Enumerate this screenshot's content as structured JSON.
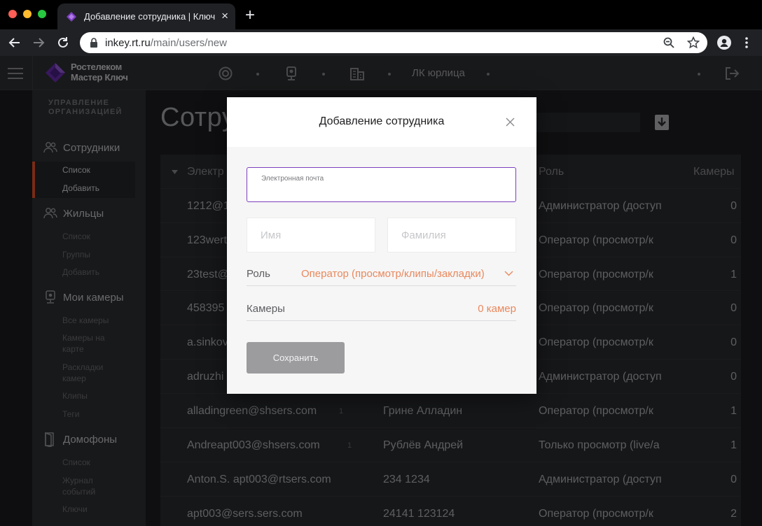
{
  "browser": {
    "tab_title": "Добавление сотрудника | Ключ",
    "tab_close": "×",
    "new_tab": "+",
    "url_host": "inkey.rt.ru",
    "url_path": "/main/users/new"
  },
  "header": {
    "logo_line1": "Ростелеком",
    "logo_line2": "Мастер Ключ",
    "company_label": "ЛК юрлица"
  },
  "sidebar": {
    "section_title_line1": "УПРАВЛЕНИЕ",
    "section_title_line2": "ОРГАНИЗАЦИЕЙ",
    "employees": {
      "label": "Сотрудники",
      "items": [
        "Список",
        "Добавить"
      ]
    },
    "residents": {
      "label": "Жильцы",
      "items": [
        "Список",
        "Группы",
        "Добавить"
      ]
    },
    "cameras": {
      "label": "Мои камеры",
      "items": [
        "Все камеры",
        "Камеры на",
        "карте",
        "Раскладки",
        "камер",
        "Клипы",
        "Теги"
      ]
    },
    "intercoms": {
      "label": "Домофоны",
      "items": [
        "Список",
        "Журнал",
        "событий",
        "Ключи"
      ]
    }
  },
  "main": {
    "title": "Сотру",
    "columns": {
      "email": "Электр",
      "role": "Роль",
      "cameras": "Камеры"
    },
    "rows": [
      {
        "email": "1212@12",
        "count": "",
        "name": "",
        "role": "Администратор (доступ",
        "cameras": "0"
      },
      {
        "email": "123wert",
        "count": "",
        "name": "",
        "role": "Оператор (просмотр/к",
        "cameras": "0"
      },
      {
        "email": "23test@",
        "count": "",
        "name": "",
        "role": "Оператор (просмотр/к",
        "cameras": "1"
      },
      {
        "email": "458395",
        "count": "",
        "name": "",
        "role": "Оператор (просмотр/к",
        "cameras": "0"
      },
      {
        "email": "a.sinkov",
        "count": "",
        "name": "",
        "role": "Оператор (просмотр/к",
        "cameras": "0"
      },
      {
        "email": "adruzhi",
        "count": "",
        "name": "",
        "role": "Администратор (доступ",
        "cameras": "0"
      },
      {
        "email": "alladingreen@shsers.com",
        "count": "1",
        "name": "Грине Алладин",
        "role": "Оператор (просмотр/к",
        "cameras": "1"
      },
      {
        "email": "Andreapt003@shsers.com",
        "count": "1",
        "name": "Рублёв Андрей",
        "role": "Только просмотр (live/а",
        "cameras": "1"
      },
      {
        "email": "Anton.S. apt003@rtsers.com",
        "count": "",
        "name": "234 1234",
        "role": "Администратор (доступ",
        "cameras": "0"
      },
      {
        "email": "apt003@sers.sers.com",
        "count": "",
        "name": "24141 123124",
        "role": "Оператор (просмотр/к",
        "cameras": "2"
      }
    ]
  },
  "modal": {
    "title": "Добавление сотрудника",
    "email_label": "Электронная почта",
    "email_value": "",
    "first_name_placeholder": "Имя",
    "last_name_placeholder": "Фамилия",
    "role_label": "Роль",
    "role_value": "Оператор (просмотр/клипы/закладки)",
    "cameras_label": "Камеры",
    "cameras_value": "0 камер",
    "save_label": "Сохранить"
  },
  "colors": {
    "accent_purple": "#7b3fbf",
    "accent_orange": "#e9885d",
    "sidebar_active": "#e8542a"
  }
}
